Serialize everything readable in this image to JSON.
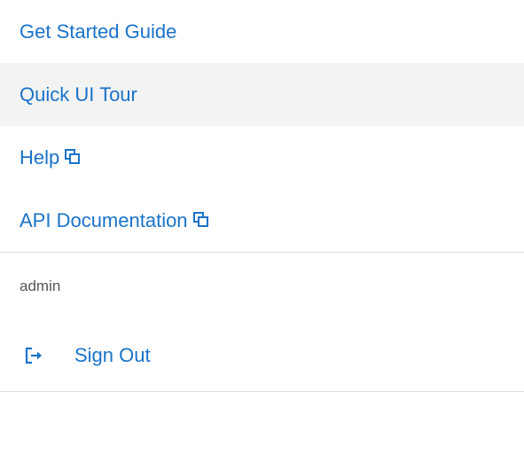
{
  "menu": {
    "items": [
      {
        "label": "Get Started Guide",
        "external": false
      },
      {
        "label": "Quick UI Tour",
        "external": false,
        "hovered": true
      },
      {
        "label": "Help",
        "external": true,
        "icon": "external-window-icon"
      },
      {
        "label": "API Documentation",
        "external": true,
        "icon": "external-window-icon"
      }
    ]
  },
  "user": {
    "name": "admin"
  },
  "signout": {
    "label": "Sign Out",
    "icon": "sign-out-icon"
  },
  "colors": {
    "link": "#1a73c9",
    "hover_bg": "#f3f3f3",
    "divider": "#dcdcdc",
    "muted_text": "#555555"
  }
}
